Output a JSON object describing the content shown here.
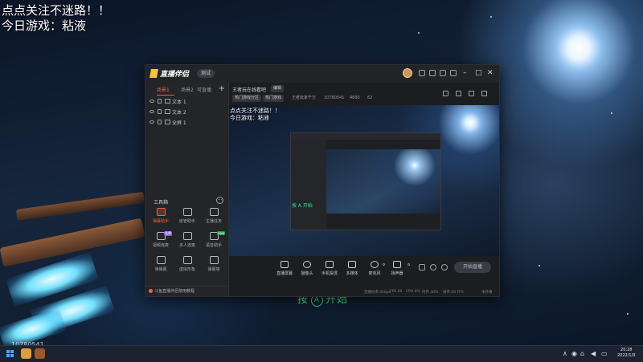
{
  "overlay": {
    "line1": "点点关注不迷路！！",
    "line2": "今日游戏：粘液"
  },
  "app": {
    "title": "直播伴侣",
    "edition": "测试",
    "tabs": [
      "场景1",
      "场景2",
      "可直播"
    ],
    "add_label": "+",
    "sources": [
      {
        "label": "文本 1"
      },
      {
        "label": "文本 2"
      },
      {
        "label": "全屏 1"
      }
    ],
    "toolbox": {
      "title": "工具箱",
      "more": "···",
      "tools": [
        {
          "label": "弹幕助手",
          "badge": "",
          "hot": true
        },
        {
          "label": "房管助手",
          "badge": "",
          "hot": false
        },
        {
          "label": "主播任务",
          "badge": "",
          "hot": false
        },
        {
          "label": "视频连麦",
          "badge": "免费",
          "hot": false
        },
        {
          "label": "多人连麦",
          "badge": "",
          "hot": false
        },
        {
          "label": "语音助手",
          "badge": "new",
          "hot": false
        },
        {
          "label": "读弹幕",
          "badge": "",
          "hot": false
        },
        {
          "label": "虚拟形象",
          "badge": "",
          "hot": false
        },
        {
          "label": "弹幕墙",
          "badge": "",
          "hot": false
        }
      ]
    },
    "notice": "斗鱼直播伴侣使用教程",
    "room": {
      "title": "王者玩在线看吧",
      "edit": "编辑",
      "category_chips": [
        "热门游戏分区",
        "热门游戏"
      ],
      "meta": [
        "王者玩家千万",
        "10780541",
        "4890",
        "62"
      ]
    },
    "preview": {
      "line1": "点点关注不迷路！！",
      "line2": "今日游戏：粘液",
      "cta": "按 A 开始"
    },
    "controls": [
      "直播屏幕",
      "摄像头",
      "手机投屏",
      "多媒体",
      "麦克风",
      "扬声器"
    ],
    "go_live": "开始直播",
    "status": [
      "直播码率 0kbps",
      "FPS 60",
      "CPU 4%",
      "内存 30%",
      "帧率 60 FPS",
      "未开播"
    ]
  },
  "desktop": {
    "cta_prefix": "按",
    "cta_button": "A",
    "cta_suffix": "开始",
    "id_text": "10780541"
  },
  "taskbar": {
    "time": "20:28",
    "date": "2022/1/9"
  }
}
